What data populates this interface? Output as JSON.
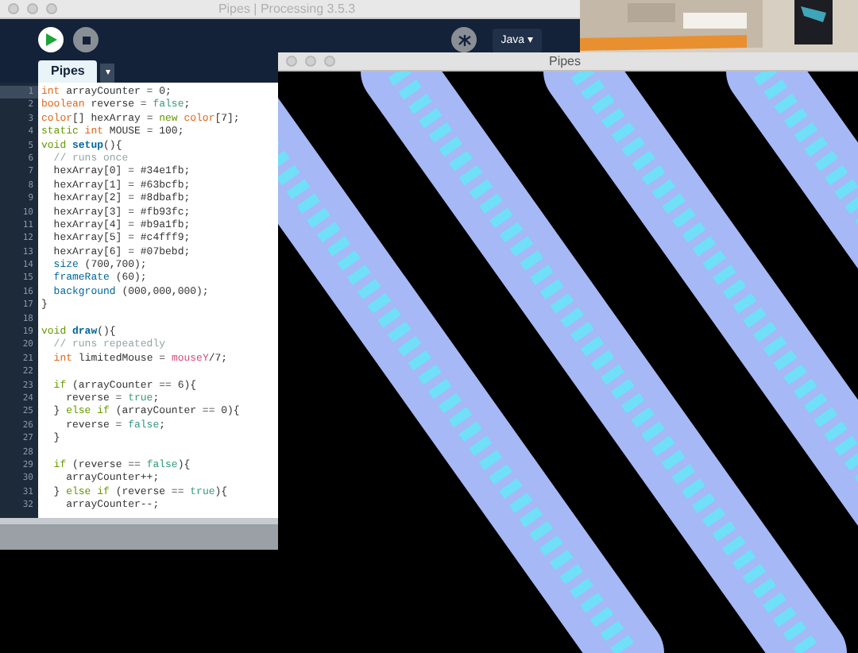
{
  "editor_window": {
    "title": "Pipes | Processing 3.5.3",
    "mode": "Java ▾",
    "tab": {
      "label": "Pipes",
      "selected": true,
      "menu": "▾"
    },
    "lines": [
      {
        "number": "1",
        "tokens": [
          {
            "text": "int",
            "kind": "type"
          },
          {
            "text": " arrayCounter = 0;",
            "kind": "plain"
          }
        ]
      },
      {
        "number": "2",
        "tokens": [
          {
            "text": "boolean",
            "kind": "type"
          },
          {
            "text": " reverse = ",
            "kind": "plain"
          },
          {
            "text": "false",
            "kind": "literal"
          },
          {
            "text": ";",
            "kind": "plain"
          }
        ]
      },
      {
        "number": "3",
        "tokens": [
          {
            "text": "color",
            "kind": "type"
          },
          {
            "text": "[] hexArray = ",
            "kind": "plain"
          },
          {
            "text": "new",
            "kind": "control"
          },
          {
            "text": " color",
            "kind": "type"
          },
          {
            "text": "[7];",
            "kind": "plain"
          }
        ]
      },
      {
        "number": "4",
        "tokens": [
          {
            "text": "static",
            "kind": "control"
          },
          {
            "text": " int",
            "kind": "type"
          },
          {
            "text": " MOUSE = 100;",
            "kind": "plain"
          }
        ]
      },
      {
        "number": "5",
        "tokens": [
          {
            "text": "void",
            "kind": "control"
          },
          {
            "text": " setup",
            "kind": "defined"
          },
          {
            "text": "(){",
            "kind": "plain"
          }
        ]
      },
      {
        "number": "6",
        "tokens": [
          {
            "text": "  // runs once",
            "kind": "comment"
          }
        ]
      },
      {
        "number": "7",
        "tokens": [
          {
            "text": "  hexArray[0] = #34e1fb;",
            "kind": "plain"
          }
        ]
      },
      {
        "number": "8",
        "tokens": [
          {
            "text": "  hexArray[1] = #63bcfb;",
            "kind": "plain"
          }
        ]
      },
      {
        "number": "9",
        "tokens": [
          {
            "text": "  hexArray[2] = #8dbafb;",
            "kind": "plain"
          }
        ]
      },
      {
        "number": "10",
        "tokens": [
          {
            "text": "  hexArray[3] = #fb93fc;",
            "kind": "plain"
          }
        ]
      },
      {
        "number": "11",
        "tokens": [
          {
            "text": "  hexArray[4] = #b9a1fb;",
            "kind": "plain"
          }
        ]
      },
      {
        "number": "12",
        "tokens": [
          {
            "text": "  hexArray[5] = #c4fff9;",
            "kind": "plain"
          }
        ]
      },
      {
        "number": "13",
        "tokens": [
          {
            "text": "  hexArray[6] = #07bebd;",
            "kind": "plain"
          }
        ]
      },
      {
        "number": "14",
        "tokens": [
          {
            "text": "  size",
            "kind": "function"
          },
          {
            "text": " (700,700);",
            "kind": "plain"
          }
        ]
      },
      {
        "number": "15",
        "tokens": [
          {
            "text": "  frameRate",
            "kind": "function"
          },
          {
            "text": " (60);",
            "kind": "plain"
          }
        ]
      },
      {
        "number": "16",
        "tokens": [
          {
            "text": "  background",
            "kind": "function"
          },
          {
            "text": " (000,000,000);",
            "kind": "plain"
          }
        ]
      },
      {
        "number": "17",
        "tokens": [
          {
            "text": "}",
            "kind": "plain"
          }
        ]
      },
      {
        "number": "18"
      },
      {
        "number": "19",
        "tokens": [
          {
            "text": "void",
            "kind": "control"
          },
          {
            "text": " draw",
            "kind": "defined"
          },
          {
            "text": "(){",
            "kind": "plain"
          }
        ]
      },
      {
        "number": "20",
        "tokens": [
          {
            "text": "  // runs repeatedly",
            "kind": "comment"
          }
        ]
      },
      {
        "number": "21",
        "tokens": [
          {
            "text": "  int",
            "kind": "type"
          },
          {
            "text": " limitedMouse = ",
            "kind": "plain"
          },
          {
            "text": "mouseY",
            "kind": "builtin"
          },
          {
            "text": "/7;",
            "kind": "plain"
          }
        ]
      },
      {
        "number": "22"
      },
      {
        "number": "23",
        "tokens": [
          {
            "text": "  if",
            "kind": "control"
          },
          {
            "text": " (arrayCounter == 6){",
            "kind": "plain"
          }
        ]
      },
      {
        "number": "24",
        "tokens": [
          {
            "text": "    reverse = ",
            "kind": "plain"
          },
          {
            "text": "true",
            "kind": "literal"
          },
          {
            "text": ";",
            "kind": "plain"
          }
        ]
      },
      {
        "number": "25",
        "tokens": [
          {
            "text": "  } ",
            "kind": "plain"
          },
          {
            "text": "else if",
            "kind": "control"
          },
          {
            "text": " (arrayCounter == 0){",
            "kind": "plain"
          }
        ]
      },
      {
        "number": "26",
        "tokens": [
          {
            "text": "    reverse = ",
            "kind": "plain"
          },
          {
            "text": "false",
            "kind": "literal"
          },
          {
            "text": ";",
            "kind": "plain"
          }
        ]
      },
      {
        "number": "27",
        "tokens": [
          {
            "text": "  }",
            "kind": "plain"
          }
        ]
      },
      {
        "number": "28"
      },
      {
        "number": "29",
        "tokens": [
          {
            "text": "  if",
            "kind": "control"
          },
          {
            "text": " (reverse == ",
            "kind": "plain"
          },
          {
            "text": "false",
            "kind": "literal"
          },
          {
            "text": "){",
            "kind": "plain"
          }
        ]
      },
      {
        "number": "30",
        "tokens": [
          {
            "text": "    arrayCounter++;",
            "kind": "plain"
          }
        ]
      },
      {
        "number": "31",
        "tokens": [
          {
            "text": "  } ",
            "kind": "plain"
          },
          {
            "text": "else if",
            "kind": "control"
          },
          {
            "text": " (reverse == ",
            "kind": "plain"
          },
          {
            "text": "true",
            "kind": "literal"
          },
          {
            "text": "){",
            "kind": "plain"
          }
        ]
      },
      {
        "number": "32",
        "tokens": [
          {
            "text": "    arrayCounter--;",
            "kind": "plain"
          }
        ]
      }
    ]
  },
  "sketch_window": {
    "title": "Pipes"
  }
}
